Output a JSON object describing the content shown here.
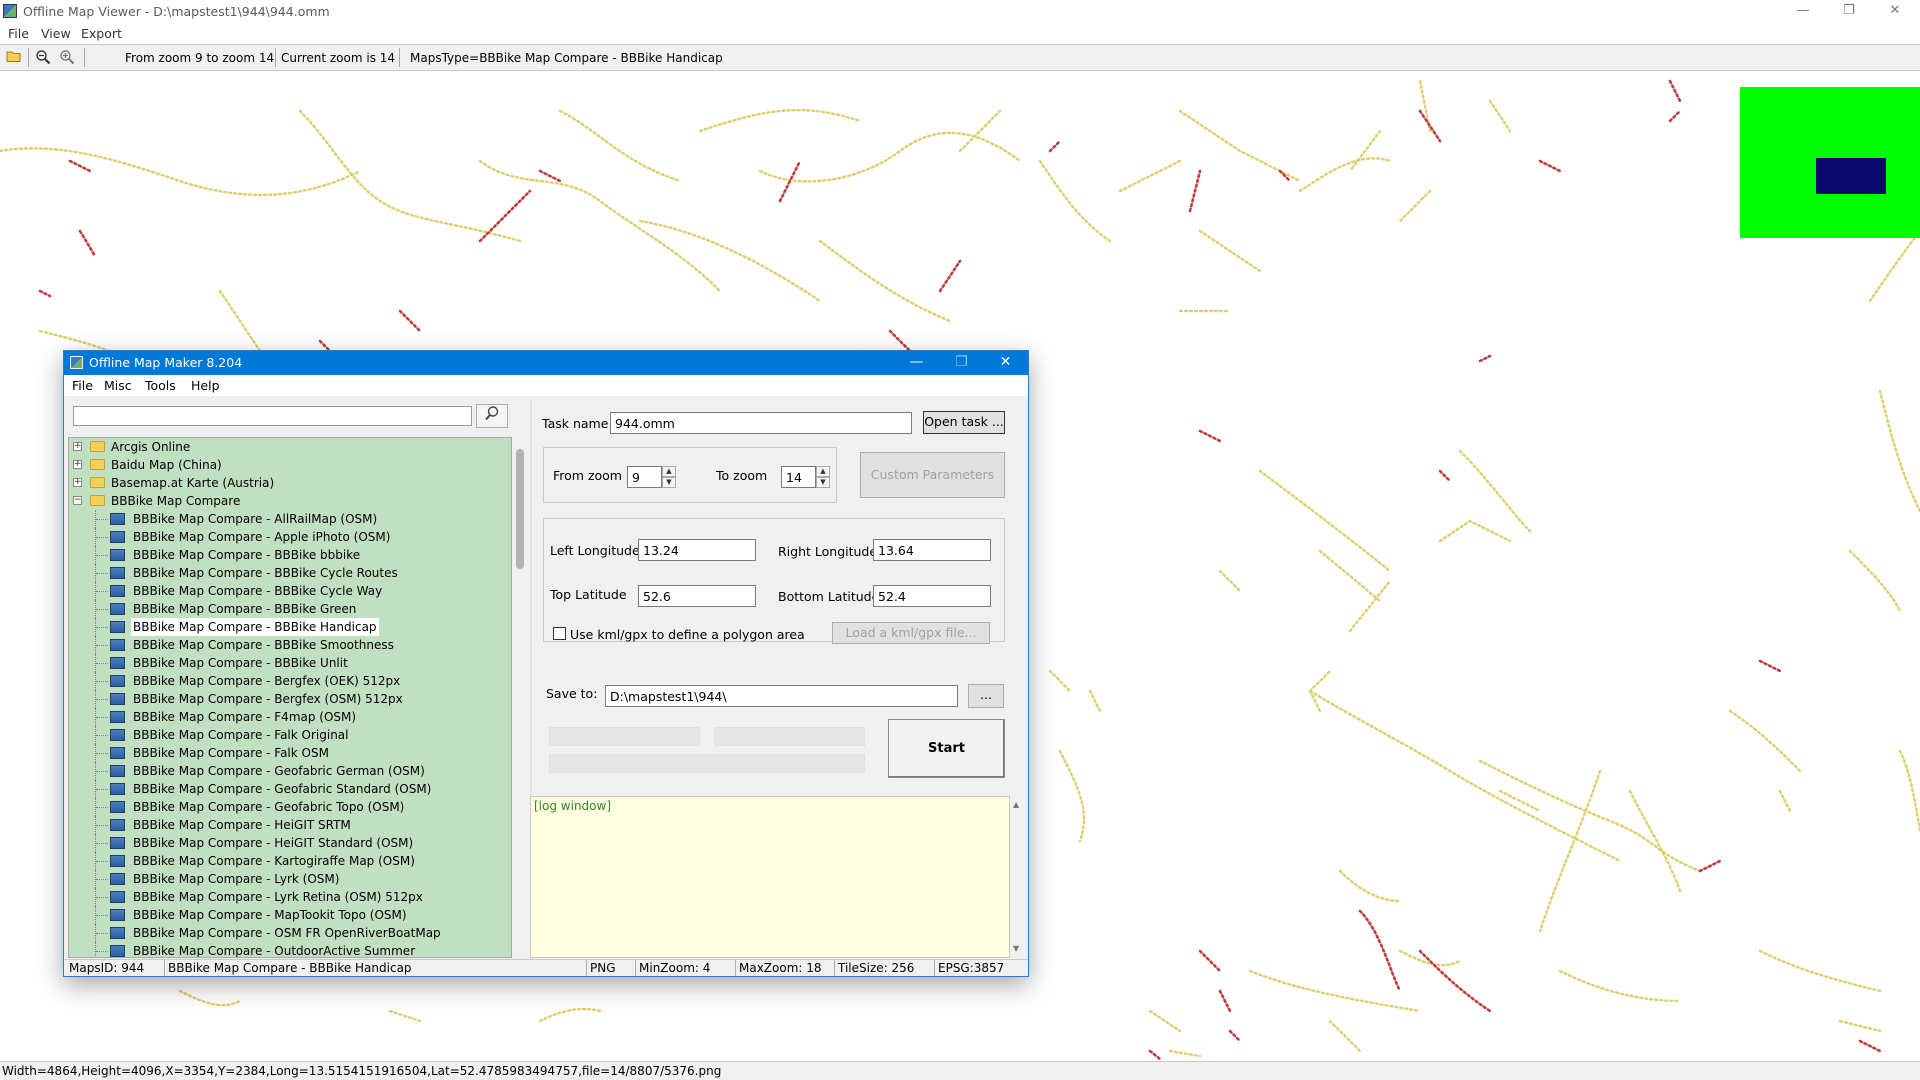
{
  "window": {
    "title": "Offline Map Viewer - D:\\mapstest1\\944\\944.omm",
    "menu": [
      "File",
      "View",
      "Export"
    ],
    "controls": {
      "minimize": "—",
      "restore": "❐",
      "close": "✕"
    }
  },
  "toolbar": {
    "zoom_range": "From zoom 9 to zoom 14",
    "current_zoom": "Current zoom is 14",
    "maps_type": "MapsType=BBBike Map Compare - BBBike Handicap"
  },
  "colors": {
    "overview_bg": "#00ff00",
    "overview_viewbox": "#0a0a6e",
    "route_yellow": "#e0d26a",
    "route_red": "#c0313a",
    "title_blue": "#0078d7",
    "tree_bg": "#c1dfc1",
    "log_bg": "#fffee0"
  },
  "statusbar": {
    "text": "Width=4864,Height=4096,X=3354,Y=2384,Long=13.5154151916504,Lat=52.4785983494757,file=14/8807/5376.png"
  },
  "maker": {
    "title": "Offline Map Maker 8.204",
    "menu": [
      "File",
      "Misc",
      "Tools",
      "Help"
    ],
    "search_value": "",
    "tree": {
      "folders": [
        "Arcgis Online",
        "Baidu Map (China)",
        "Basemap.at Karte (Austria)",
        "BBBike Map Compare"
      ],
      "items": [
        "BBBike Map Compare - AllRailMap (OSM)",
        "BBBike Map Compare - Apple iPhoto (OSM)",
        "BBBike Map Compare - BBBike bbbike",
        "BBBike Map Compare - BBBike Cycle Routes",
        "BBBike Map Compare - BBBike Cycle Way",
        "BBBike Map Compare - BBBike Green",
        "BBBike Map Compare - BBBike Handicap",
        "BBBike Map Compare - BBBike Smoothness",
        "BBBike Map Compare - BBBike Unlit",
        "BBBike Map Compare - Bergfex (OEK) 512px",
        "BBBike Map Compare - Bergfex (OSM) 512px",
        "BBBike Map Compare - F4map (OSM)",
        "BBBike Map Compare - Falk Original",
        "BBBike Map Compare - Falk OSM",
        "BBBike Map Compare - Geofabric German (OSM)",
        "BBBike Map Compare - Geofabric Standard (OSM)",
        "BBBike Map Compare - Geofabric Topo (OSM)",
        "BBBike Map Compare - HeiGIT SRTM",
        "BBBike Map Compare - HeiGIT Standard (OSM)",
        "BBBike Map Compare - Kartogiraffe Map (OSM)",
        "BBBike Map Compare - Lyrk (OSM)",
        "BBBike Map Compare - Lyrk Retina (OSM) 512px",
        "BBBike Map Compare - MapTookit Topo (OSM)",
        "BBBike Map Compare - OSM FR OpenRiverBoatMap",
        "BBBike Map Compare - OutdoorActive Summer"
      ],
      "selected_item": "BBBike Map Compare - BBBike Handicap"
    },
    "task_name_label": "Task name",
    "task_name_value": "944.omm",
    "open_task_label": "Open task ...",
    "from_zoom_label": "From zoom",
    "from_zoom_value": "9",
    "to_zoom_label": "To zoom",
    "to_zoom_value": "14",
    "custom_params_label": "Custom Parameters",
    "left_lon_label": "Left Longitude",
    "left_lon_value": "13.24",
    "right_lon_label": "Right Longitude",
    "right_lon_value": "13.64",
    "top_lat_label": "Top Latitude",
    "top_lat_value": "52.6",
    "bottom_lat_label": "Bottom Latitude",
    "bottom_lat_value": "52.4",
    "kml_check_label": "Use kml/gpx to define a polygon area",
    "kml_checked": false,
    "load_kml_label": "Load a kml/gpx file...",
    "save_to_label": "Save to:",
    "save_to_value": "D:\\mapstest1\\944\\",
    "browse_label": "...",
    "start_label": "Start",
    "log_text": "[log window]",
    "status": {
      "maps_id": "MapsID: 944",
      "map_name": "BBBike Map Compare - BBBike Handicap",
      "format": "PNG",
      "min_zoom": "MinZoom: 4",
      "max_zoom": "MaxZoom: 18",
      "tile_size": "TileSize: 256",
      "epsg": "EPSG:3857"
    }
  }
}
